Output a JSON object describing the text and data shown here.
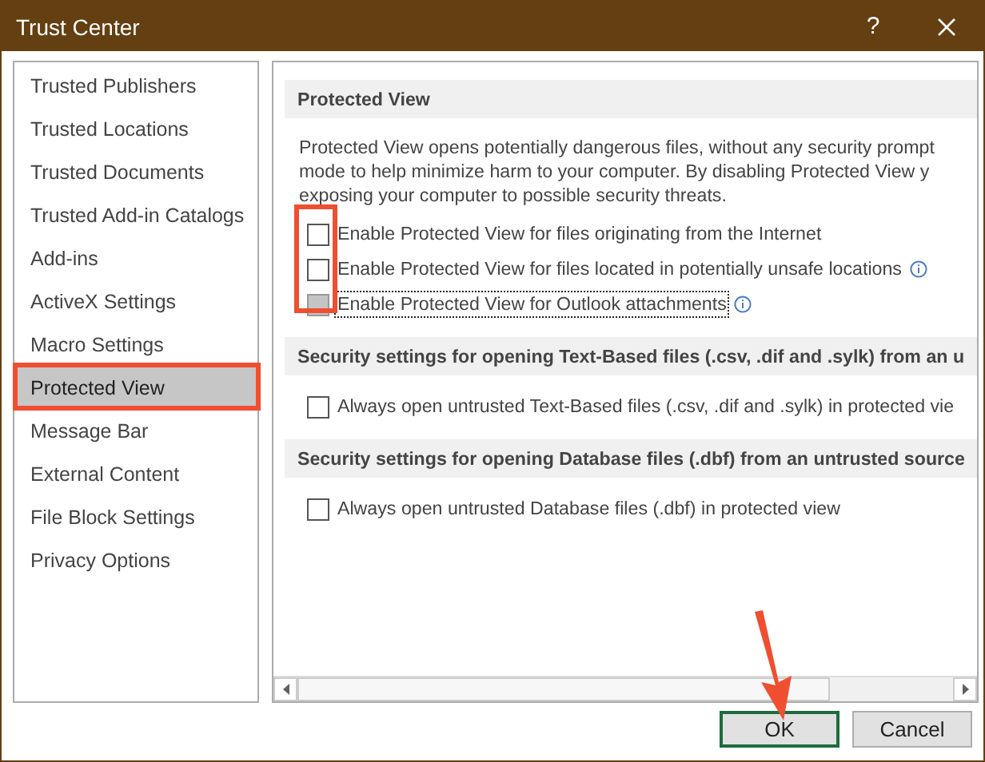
{
  "window": {
    "title": "Trust Center",
    "help": "?"
  },
  "sidebar": {
    "items": [
      {
        "label": "Trusted Publishers",
        "selected": false
      },
      {
        "label": "Trusted Locations",
        "selected": false
      },
      {
        "label": "Trusted Documents",
        "selected": false
      },
      {
        "label": "Trusted Add-in Catalogs",
        "selected": false
      },
      {
        "label": "Add-ins",
        "selected": false
      },
      {
        "label": "ActiveX Settings",
        "selected": false
      },
      {
        "label": "Macro Settings",
        "selected": false
      },
      {
        "label": "Protected View",
        "selected": true
      },
      {
        "label": "Message Bar",
        "selected": false
      },
      {
        "label": "External Content",
        "selected": false
      },
      {
        "label": "File Block Settings",
        "selected": false
      },
      {
        "label": "Privacy Options",
        "selected": false
      }
    ]
  },
  "sections": [
    {
      "title": "Protected View",
      "description": "Protected View opens potentially dangerous files, without any security prompt\nmode to help minimize harm to your computer. By disabling Protected View y\nexposing your computer to possible security threats.",
      "options": [
        {
          "label": "Enable Protected View for files originating from the Internet",
          "checked": false,
          "disabled": false,
          "info": false,
          "focused": false
        },
        {
          "label": "Enable Protected View for files located in potentially unsafe locations",
          "checked": false,
          "disabled": false,
          "info": true,
          "focused": false
        },
        {
          "label": "Enable Protected View for Outlook attachments",
          "checked": false,
          "disabled": true,
          "info": true,
          "focused": true
        }
      ]
    },
    {
      "title": "Security settings for opening Text-Based files (.csv, .dif and .sylk) from an u",
      "options": [
        {
          "label": "Always open untrusted Text-Based files (.csv, .dif and .sylk) in protected vie",
          "checked": false,
          "disabled": false,
          "info": false,
          "focused": false
        }
      ]
    },
    {
      "title": "Security settings for opening Database files (.dbf) from an untrusted source",
      "options": [
        {
          "label": "Always open untrusted Database files (.dbf) in protected view",
          "checked": false,
          "disabled": false,
          "info": false,
          "focused": false
        }
      ]
    }
  ],
  "buttons": [
    {
      "label": "OK",
      "default": true
    },
    {
      "label": "Cancel",
      "default": false
    }
  ]
}
